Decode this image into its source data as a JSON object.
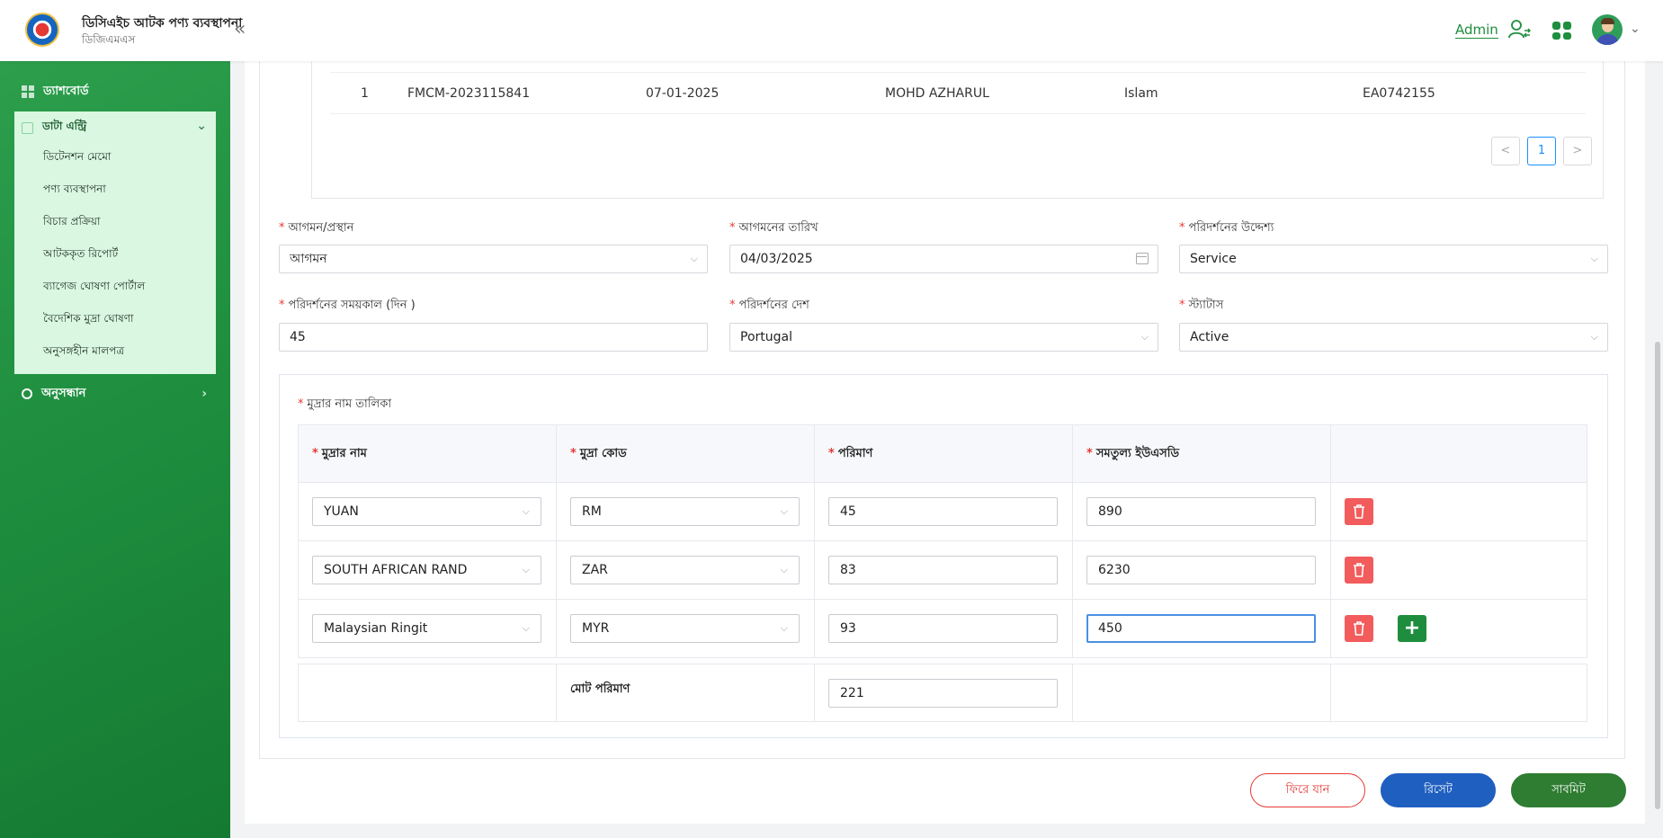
{
  "header": {
    "app_title": "ডিসিএইচ আটক পণ্য ব্যবস্থাপনা",
    "app_subtitle": "ডিজিএমএস",
    "user_label": "Admin"
  },
  "sidebar": {
    "dashboard": "ড্যাশবোর্ড",
    "data_entry": "ডাটা এন্ট্রি",
    "sub_items": [
      "ডিটেনশন মেমো",
      "পণ্য ব্যবস্থাপনা",
      "বিচার প্রক্রিয়া",
      "আটককৃত রিপোর্ট",
      "ব্যাগেজ ঘোষণা পোর্টাল",
      "বৈদেশিক মুদ্রা ঘোষণা",
      "অনুসঙ্গহীন মালপত্র"
    ],
    "search": "অনুসন্ধান"
  },
  "top_table": {
    "row": [
      "1",
      "FMCM-2023115841",
      "07-01-2025",
      "MOHD AZHARUL",
      "Islam",
      "EA0742155"
    ],
    "page": "1",
    "prev": "<",
    "next": ">"
  },
  "form": {
    "arrival_departure": {
      "label": "আগমন/প্রস্থান",
      "value": "আগমন"
    },
    "arrival_date": {
      "label": "আগমনের তারিখ",
      "value": "04/03/2025"
    },
    "visit_purpose": {
      "label": "পরিদর্শনের উদ্দেশ্য",
      "value": "Service"
    },
    "visit_duration": {
      "label": "পরিদর্শনের সময়কাল (দিন )",
      "value": "45"
    },
    "visit_country": {
      "label": "পরিদর্শনের দেশ",
      "value": "Portugal"
    },
    "status": {
      "label": "স্ট্যাটাস",
      "value": "Active"
    }
  },
  "currency_section": {
    "title": "মুদ্রার নাম তালিকা",
    "headers": [
      "মুদ্রার নাম",
      "মুদ্রা কোড",
      "পরিমাণ",
      "সমতুল্য ইউএসডি"
    ],
    "rows": [
      {
        "name": "YUAN",
        "code": "RM",
        "amount": "45",
        "usd": "890"
      },
      {
        "name": "SOUTH AFRICAN RAND",
        "code": "ZAR",
        "amount": "83",
        "usd": "6230"
      },
      {
        "name": "Malaysian Ringit",
        "code": "MYR",
        "amount": "93",
        "usd": "450"
      }
    ],
    "total_label": "মোট পরিমাণ",
    "total_value": "221"
  },
  "actions": {
    "back": "ফিরে যান",
    "reset": "রিসেট",
    "submit": "সাবমিট"
  },
  "colors": {
    "primary_green": "#1e8e3e",
    "danger_red": "#f25c5c",
    "reset_blue": "#1f5fbf",
    "focus_blue": "#4a90e2"
  }
}
